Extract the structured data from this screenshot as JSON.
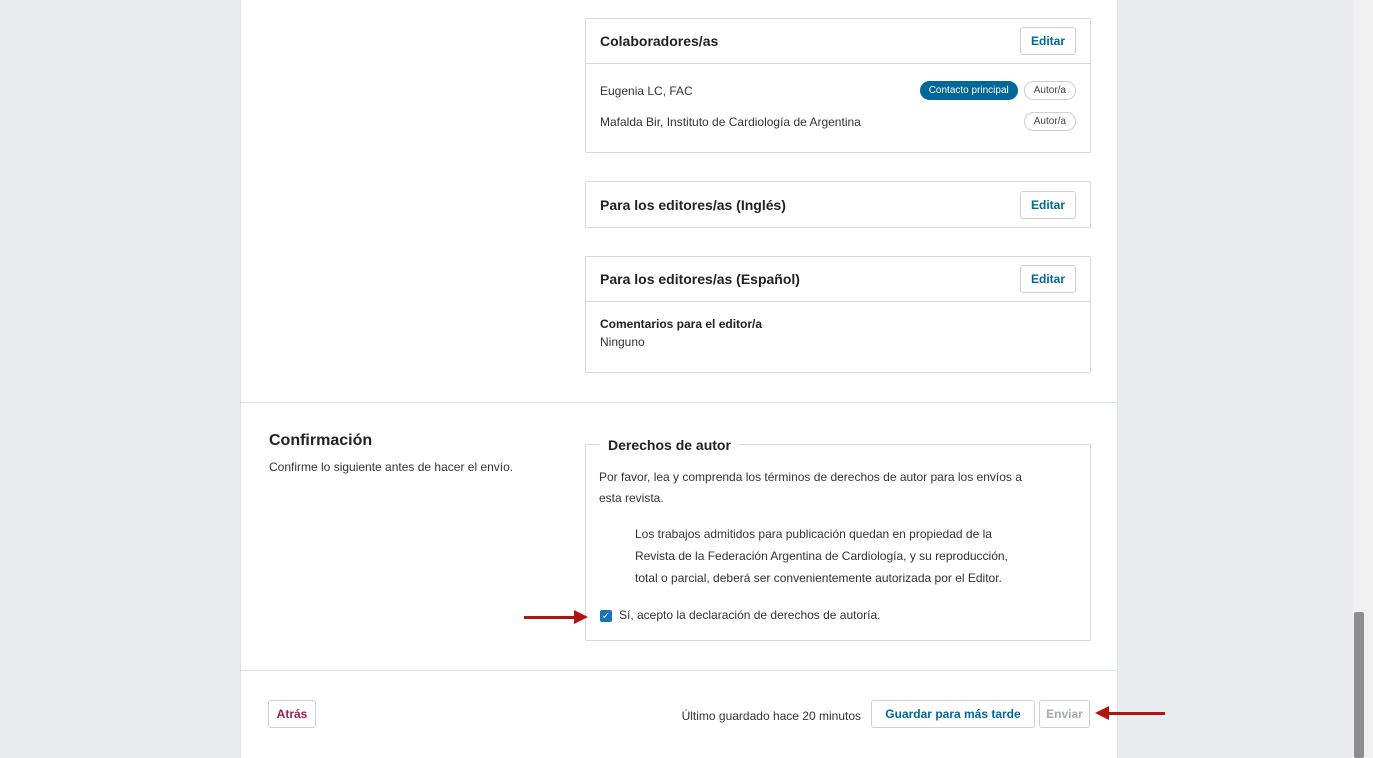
{
  "contributors": {
    "title": "Colaboradores/as",
    "edit_label": "Editar",
    "rows": [
      {
        "name": "Eugenia LC, FAC",
        "badges": [
          "Contacto principal",
          "Autor/a"
        ]
      },
      {
        "name": "Mafalda Bir, Instituto de Cardiología de Argentina",
        "badges": [
          "Autor/a"
        ]
      }
    ]
  },
  "editors_en": {
    "title": "Para los editores/as (Inglés)",
    "edit_label": "Editar"
  },
  "editors_es": {
    "title": "Para los editores/as (Español)",
    "edit_label": "Editar",
    "comments_label": "Comentarios para el editor/a",
    "comments_value": "Ninguno"
  },
  "confirmation": {
    "title": "Confirmación",
    "description": "Confirme lo siguiente antes de hacer el envío.",
    "copyright": {
      "legend": "Derechos de autor",
      "intro_line1": "Por favor, lea y comprenda los términos de derechos de autor para los envíos a",
      "intro_line2": "esta revista.",
      "statement_line1": "Los trabajos admitidos para publicación quedan en propiedad de la",
      "statement_line2": "Revista de la Federación Argentina de Cardiología, y su reproducción,",
      "statement_line3": "total o parcial, deberá ser convenientemente autorizada por el Editor.",
      "checkbox_label": "Sí, acepto la declaración de derechos de autoría.",
      "checkbox_checked": true
    }
  },
  "footer": {
    "back_label": "Atrás",
    "saved_status": "Último guardado hace 20 minutos",
    "save_later_label": "Guardar para más tarde",
    "submit_label": "Enviar"
  },
  "colors": {
    "accent": "#006798",
    "back_button": "#9b1d5c",
    "arrow": "#b0160f"
  }
}
